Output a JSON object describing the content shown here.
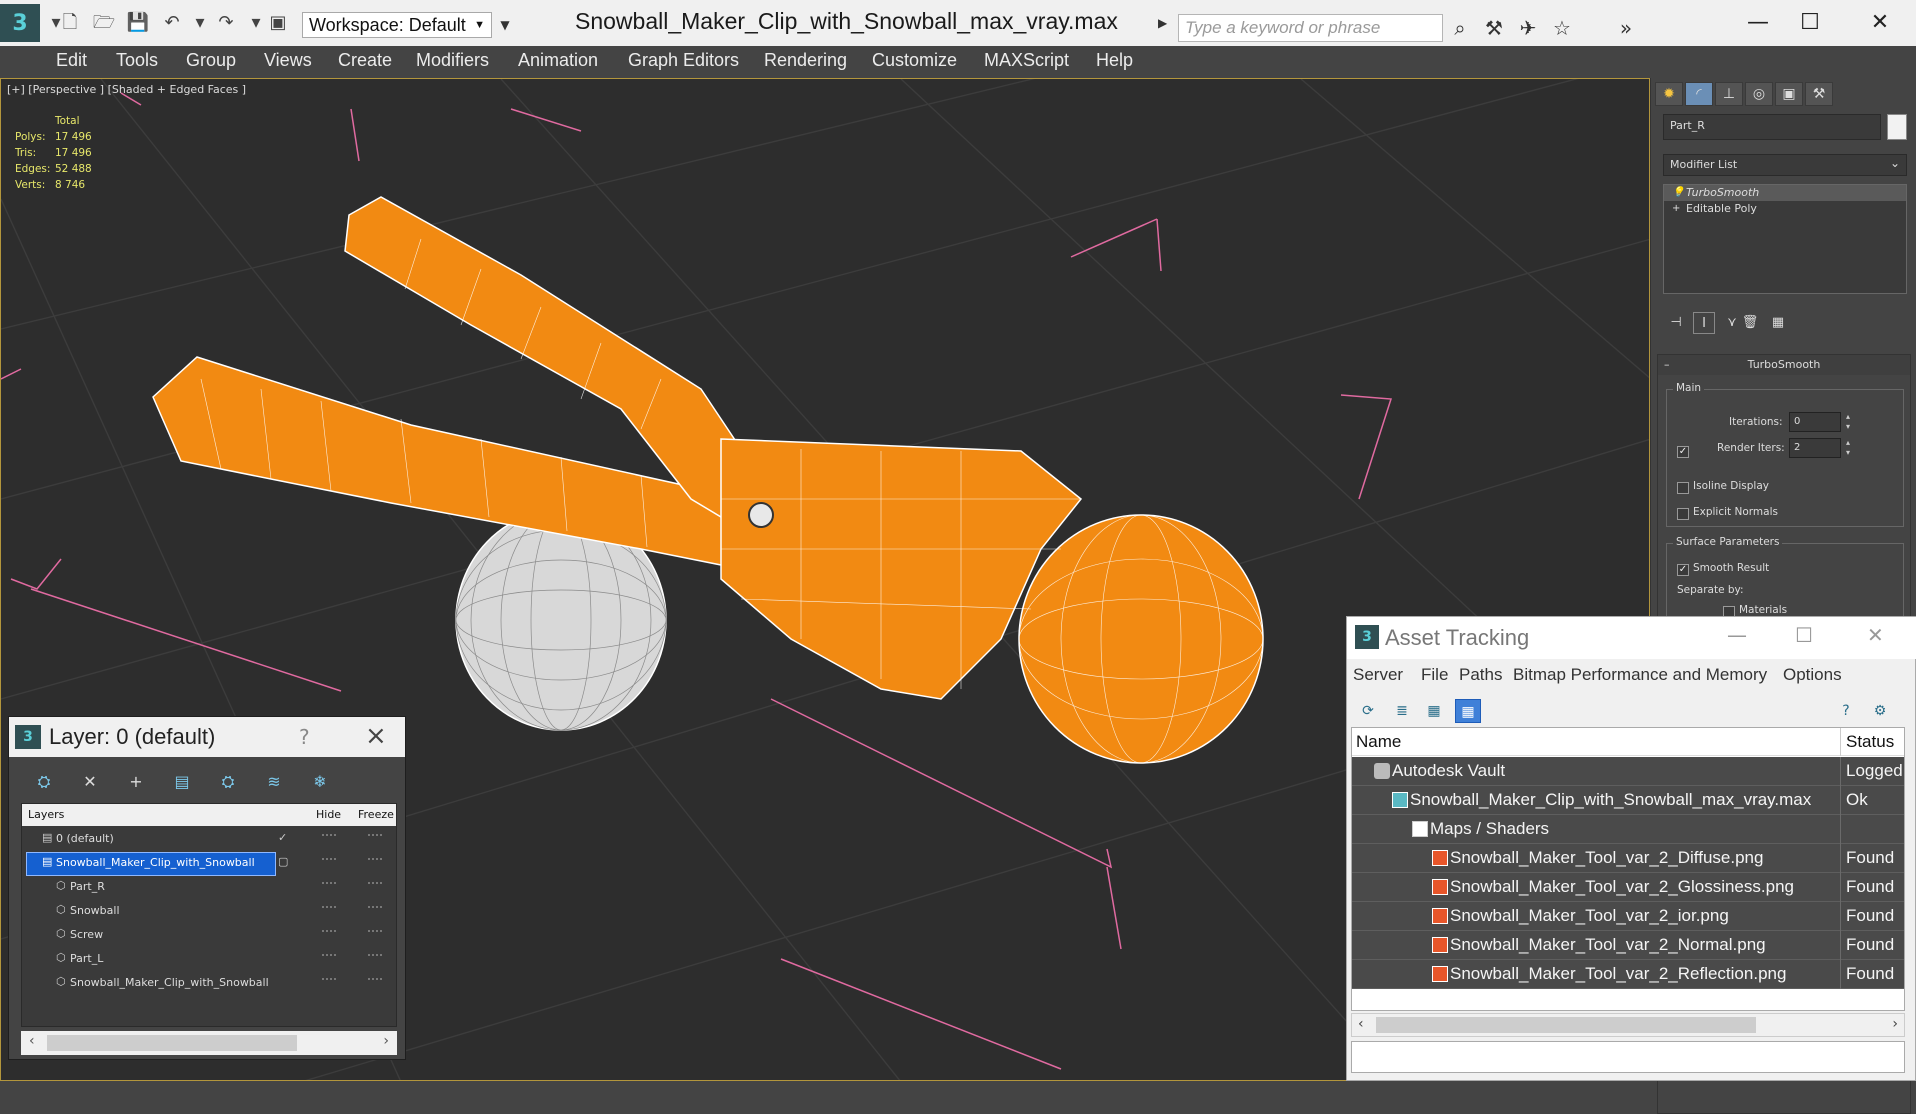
{
  "titlebar": {
    "workspace": "Workspace: Default",
    "document_title": "Snowball_Maker_Clip_with_Snowball_max_vray.max",
    "search_placeholder": "Type a keyword or phrase"
  },
  "menu": [
    "Edit",
    "Tools",
    "Group",
    "Views",
    "Create",
    "Modifiers",
    "Animation",
    "Graph Editors",
    "Rendering",
    "Customize",
    "MAXScript",
    "Help"
  ],
  "viewport": {
    "label": "[+] [Perspective ] [Shaded + Edged Faces ]",
    "stats": {
      "header": "Total",
      "rows": [
        {
          "label": "Polys:",
          "value": "17 496"
        },
        {
          "label": "Tris:",
          "value": "17 496"
        },
        {
          "label": "Edges:",
          "value": "52 488"
        },
        {
          "label": "Verts:",
          "value": "8 746"
        }
      ]
    },
    "colors": {
      "object": "#f28a12",
      "wire": "#ffffff",
      "snowball": "#d8d8d8",
      "grid": "#3c3c3c",
      "bbox": "#e06aa0"
    }
  },
  "command_panel": {
    "object_name": "Part_R",
    "modifier_list": "Modifier List",
    "stack": [
      "TurboSmooth",
      "Editable Poly"
    ],
    "rollout_title": "TurboSmooth",
    "main_group": "Main",
    "iterations_label": "Iterations:",
    "iterations_value": "0",
    "render_iters_label": "Render Iters:",
    "render_iters_value": "2",
    "render_iters_checked": true,
    "isoline_label": "Isoline Display",
    "explicit_normals_label": "Explicit Normals",
    "surface_group": "Surface Parameters",
    "smooth_result_label": "Smooth Result",
    "smooth_result_checked": true,
    "separate_by_label": "Separate by:",
    "materials_label": "Materials"
  },
  "layer_dialog": {
    "title": "Layer: 0 (default)",
    "help": "?",
    "columns": {
      "layers": "Layers",
      "hide": "Hide",
      "freeze": "Freeze"
    },
    "rows": [
      {
        "name": "0 (default)"
      },
      {
        "name": "Snowball_Maker_Clip_with_Snowball"
      },
      {
        "name": "Part_R"
      },
      {
        "name": "Snowball"
      },
      {
        "name": "Screw"
      },
      {
        "name": "Part_L"
      },
      {
        "name": "Snowball_Maker_Clip_with_Snowball"
      }
    ]
  },
  "asset_tracking": {
    "title": "Asset Tracking",
    "menu": [
      "Server",
      "File",
      "Paths",
      "Bitmap Performance and Memory",
      "Options"
    ],
    "columns": {
      "name": "Name",
      "status": "Status"
    },
    "rows": [
      {
        "name": "Autodesk Vault",
        "status": "Logged."
      },
      {
        "name": "Snowball_Maker_Clip_with_Snowball_max_vray.max",
        "status": "Ok"
      },
      {
        "name": "Maps / Shaders",
        "status": ""
      },
      {
        "name": "Snowball_Maker_Tool_var_2_Diffuse.png",
        "status": "Found"
      },
      {
        "name": "Snowball_Maker_Tool_var_2_Glossiness.png",
        "status": "Found"
      },
      {
        "name": "Snowball_Maker_Tool_var_2_ior.png",
        "status": "Found"
      },
      {
        "name": "Snowball_Maker_Tool_var_2_Normal.png",
        "status": "Found"
      },
      {
        "name": "Snowball_Maker_Tool_var_2_Reflection.png",
        "status": "Found"
      }
    ]
  }
}
